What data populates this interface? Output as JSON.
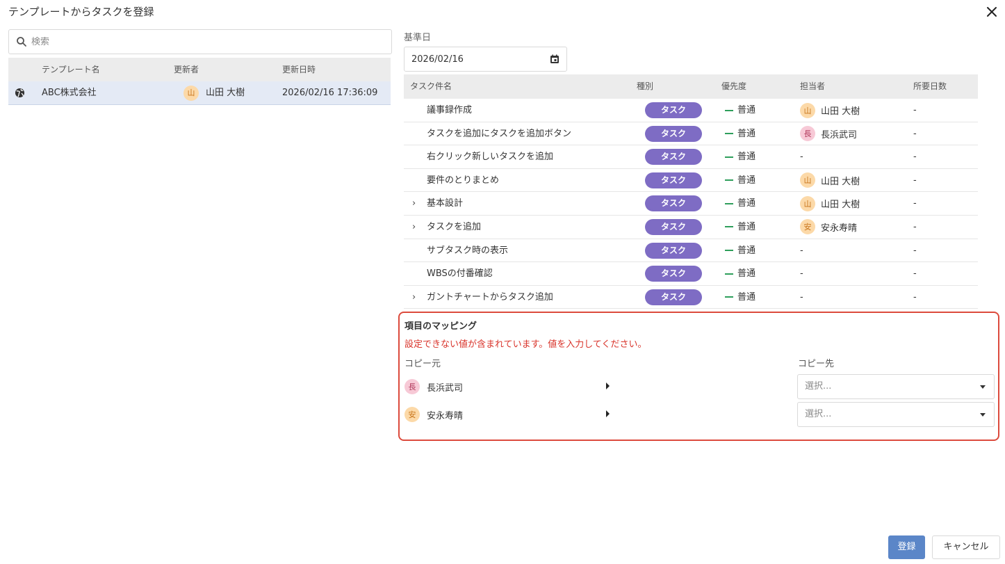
{
  "dialog": {
    "title": "テンプレートからタスクを登録"
  },
  "search": {
    "placeholder": "検索",
    "value": ""
  },
  "template_table": {
    "headers": {
      "name": "テンプレート名",
      "updater": "更新者",
      "updated_at": "更新日時"
    },
    "rows": [
      {
        "name": "ABC株式会社",
        "updater_initial": "山",
        "updater": "山田 大樹",
        "updated_at": "2026/02/16 17:36:09"
      }
    ]
  },
  "base_date": {
    "label": "基準日",
    "value": "2026/02/16"
  },
  "task_table": {
    "headers": {
      "name": "タスク件名",
      "type": "種別",
      "priority": "優先度",
      "assignee": "担当者",
      "days": "所要日数"
    },
    "rows": [
      {
        "expandable": false,
        "name": "議事録作成",
        "type": "タスク",
        "priority": "普通",
        "assignee_initial": "山",
        "assignee": "山田 大樹",
        "days": "-"
      },
      {
        "expandable": false,
        "name": "タスクを追加にタスクを追加ボタン",
        "type": "タスク",
        "priority": "普通",
        "assignee_initial": "長",
        "assignee": "長浜武司",
        "days": "-"
      },
      {
        "expandable": false,
        "name": "右クリック新しいタスクを追加",
        "type": "タスク",
        "priority": "普通",
        "assignee_initial": "",
        "assignee": "-",
        "days": "-"
      },
      {
        "expandable": false,
        "name": "要件のとりまとめ",
        "type": "タスク",
        "priority": "普通",
        "assignee_initial": "山",
        "assignee": "山田 大樹",
        "days": "-"
      },
      {
        "expandable": true,
        "name": "基本設計",
        "type": "タスク",
        "priority": "普通",
        "assignee_initial": "山",
        "assignee": "山田 大樹",
        "days": "-"
      },
      {
        "expandable": true,
        "name": "タスクを追加",
        "type": "タスク",
        "priority": "普通",
        "assignee_initial": "安",
        "assignee": "安永寿晴",
        "days": "-"
      },
      {
        "expandable": false,
        "name": "サブタスク時の表示",
        "type": "タスク",
        "priority": "普通",
        "assignee_initial": "",
        "assignee": "-",
        "days": "-"
      },
      {
        "expandable": false,
        "name": "WBSの付番確認",
        "type": "タスク",
        "priority": "普通",
        "assignee_initial": "",
        "assignee": "-",
        "days": "-"
      },
      {
        "expandable": true,
        "name": "ガントチャートからタスク追加",
        "type": "タスク",
        "priority": "普通",
        "assignee_initial": "",
        "assignee": "-",
        "days": "-"
      }
    ]
  },
  "mapping": {
    "title": "項目のマッピング",
    "error": "設定できない値が含まれています。値を入力してください。",
    "source_header": "コピー元",
    "dest_header": "コピー先",
    "rows": [
      {
        "initial": "長",
        "source": "長浜武司",
        "placeholder": "選択..."
      },
      {
        "initial": "安",
        "source": "安永寿晴",
        "placeholder": "選択..."
      }
    ]
  },
  "footer": {
    "submit_label": "登録",
    "cancel_label": "キャンセル"
  },
  "colors": {
    "accent": "#5b86c8",
    "badge": "#7e6cc4",
    "error": "#d9342b",
    "priority": "#2e9e5b"
  }
}
